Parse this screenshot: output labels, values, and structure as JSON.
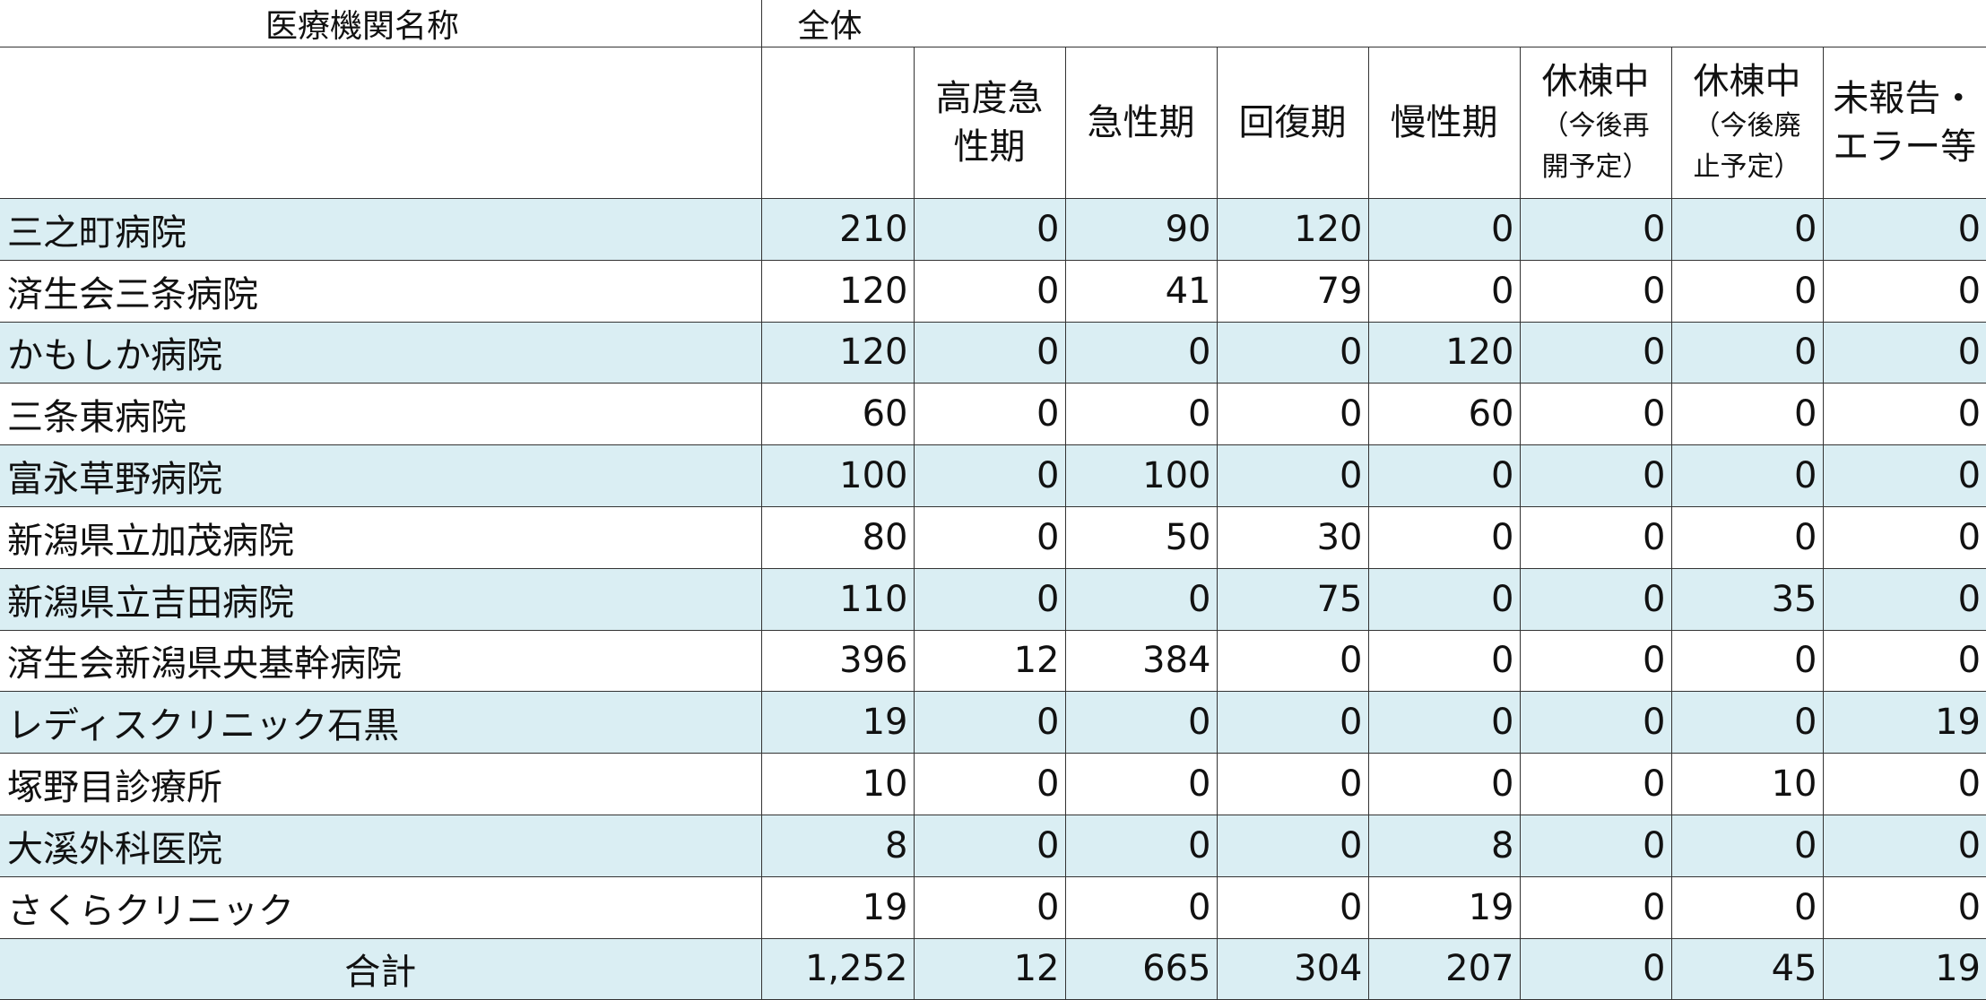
{
  "header": {
    "facility_label": "医療機関名称",
    "total_label": "全体"
  },
  "columns": [
    {
      "lines": [
        ""
      ]
    },
    {
      "lines": [
        "高度急",
        "性期"
      ]
    },
    {
      "lines": [
        "急性期"
      ]
    },
    {
      "lines": [
        "回復期"
      ]
    },
    {
      "lines": [
        "慢性期"
      ]
    },
    {
      "lines": [
        "休棟中",
        "（今後再",
        "開予定）"
      ]
    },
    {
      "lines": [
        "休棟中",
        "（今後廃",
        "止予定）"
      ]
    },
    {
      "lines": [
        "未報告・",
        "エラー等"
      ]
    }
  ],
  "rows": [
    {
      "name": "三之町病院",
      "values": [
        "210",
        "0",
        "90",
        "120",
        "0",
        "0",
        "0",
        "0"
      ]
    },
    {
      "name": "済生会三条病院",
      "values": [
        "120",
        "0",
        "41",
        "79",
        "0",
        "0",
        "0",
        "0"
      ]
    },
    {
      "name": "かもしか病院",
      "values": [
        "120",
        "0",
        "0",
        "0",
        "120",
        "0",
        "0",
        "0"
      ]
    },
    {
      "name": "三条東病院",
      "values": [
        "60",
        "0",
        "0",
        "0",
        "60",
        "0",
        "0",
        "0"
      ]
    },
    {
      "name": "富永草野病院",
      "values": [
        "100",
        "0",
        "100",
        "0",
        "0",
        "0",
        "0",
        "0"
      ]
    },
    {
      "name": "新潟県立加茂病院",
      "values": [
        "80",
        "0",
        "50",
        "30",
        "0",
        "0",
        "0",
        "0"
      ]
    },
    {
      "name": "新潟県立吉田病院",
      "values": [
        "110",
        "0",
        "0",
        "75",
        "0",
        "0",
        "35",
        "0"
      ]
    },
    {
      "name": "済生会新潟県央基幹病院",
      "values": [
        "396",
        "12",
        "384",
        "0",
        "0",
        "0",
        "0",
        "0"
      ]
    },
    {
      "name": "レディスクリニック石黒",
      "values": [
        "19",
        "0",
        "0",
        "0",
        "0",
        "0",
        "0",
        "19"
      ]
    },
    {
      "name": "塚野目診療所",
      "values": [
        "10",
        "0",
        "0",
        "0",
        "0",
        "0",
        "10",
        "0"
      ]
    },
    {
      "name": "大溪外科医院",
      "values": [
        "8",
        "0",
        "0",
        "0",
        "8",
        "0",
        "0",
        "0"
      ]
    },
    {
      "name": "さくらクリニック",
      "values": [
        "19",
        "0",
        "0",
        "0",
        "19",
        "0",
        "0",
        "0"
      ]
    }
  ],
  "total": {
    "label": "合計",
    "values": [
      "1,252",
      "12",
      "665",
      "304",
      "207",
      "0",
      "45",
      "19"
    ]
  },
  "colors": {
    "shade": "#daeef3",
    "grid": "#333333"
  }
}
